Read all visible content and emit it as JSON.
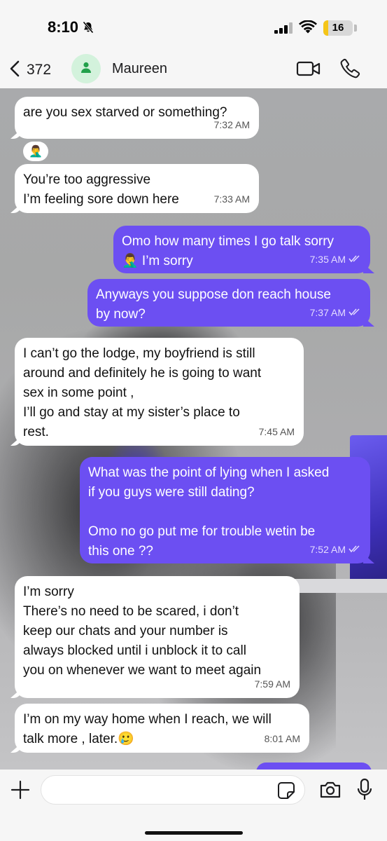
{
  "status_bar": {
    "time": "8:10",
    "battery_level": 16,
    "battery_label": "16",
    "icons": [
      "bell-slash-icon",
      "signal-icon",
      "wifi-icon",
      "battery-icon"
    ]
  },
  "header": {
    "back_count": "372",
    "contact_name": "Maureen",
    "icons": [
      "chevron-left-icon",
      "person-icon",
      "video-camera-icon",
      "phone-icon"
    ]
  },
  "colors": {
    "outgoing_bubble": "#6c4ff2",
    "incoming_bubble": "#ffffff",
    "avatar_bg": "#d3f2dc",
    "avatar_icon": "#22a04b",
    "battery_fill": "#f5c518"
  },
  "messages": [
    {
      "direction": "incoming",
      "text": "are you sex starved or something?",
      "time": "7:32 AM"
    },
    {
      "direction": "incoming",
      "reaction": "🤦‍♂️"
    },
    {
      "direction": "incoming",
      "text": "You’re too aggressive\nI’m feeling sore down here",
      "time": "7:33 AM"
    },
    {
      "direction": "outgoing",
      "text": "Omo how many times I go talk sorry\n🤦‍♂️ I’m sorry",
      "time": "7:35 AM",
      "read": true
    },
    {
      "direction": "outgoing",
      "text": "Anyways you suppose don reach house\nby now?",
      "time": "7:37 AM",
      "read": true
    },
    {
      "direction": "incoming",
      "text": "I can’t go the lodge, my boyfriend is still\naround and definitely he is going to want\nsex in some point ,\nI’ll go and stay at my sister’s place to\nrest.",
      "time": "7:45 AM"
    },
    {
      "direction": "outgoing",
      "text": "What was the point of lying when I asked\nif you guys were still dating?\n\nOmo no go put me for trouble wetin be\nthis one ??",
      "time": "7:52 AM",
      "read": true
    },
    {
      "direction": "incoming",
      "text": "I’m sorry\nThere’s no need to be scared, i don’t\nkeep our chats and your number is\nalways blocked until i unblock it to call\nyou on whenever we want to meet again",
      "time": "7:59 AM"
    },
    {
      "direction": "incoming",
      "text": "I’m on my way home when I reach, we will\ntalk more , later.🥲",
      "time": "8:01 AM"
    }
  ],
  "composer": {
    "input_value": "",
    "icons": [
      "plus-icon",
      "sticker-icon",
      "camera-icon",
      "microphone-icon"
    ]
  }
}
